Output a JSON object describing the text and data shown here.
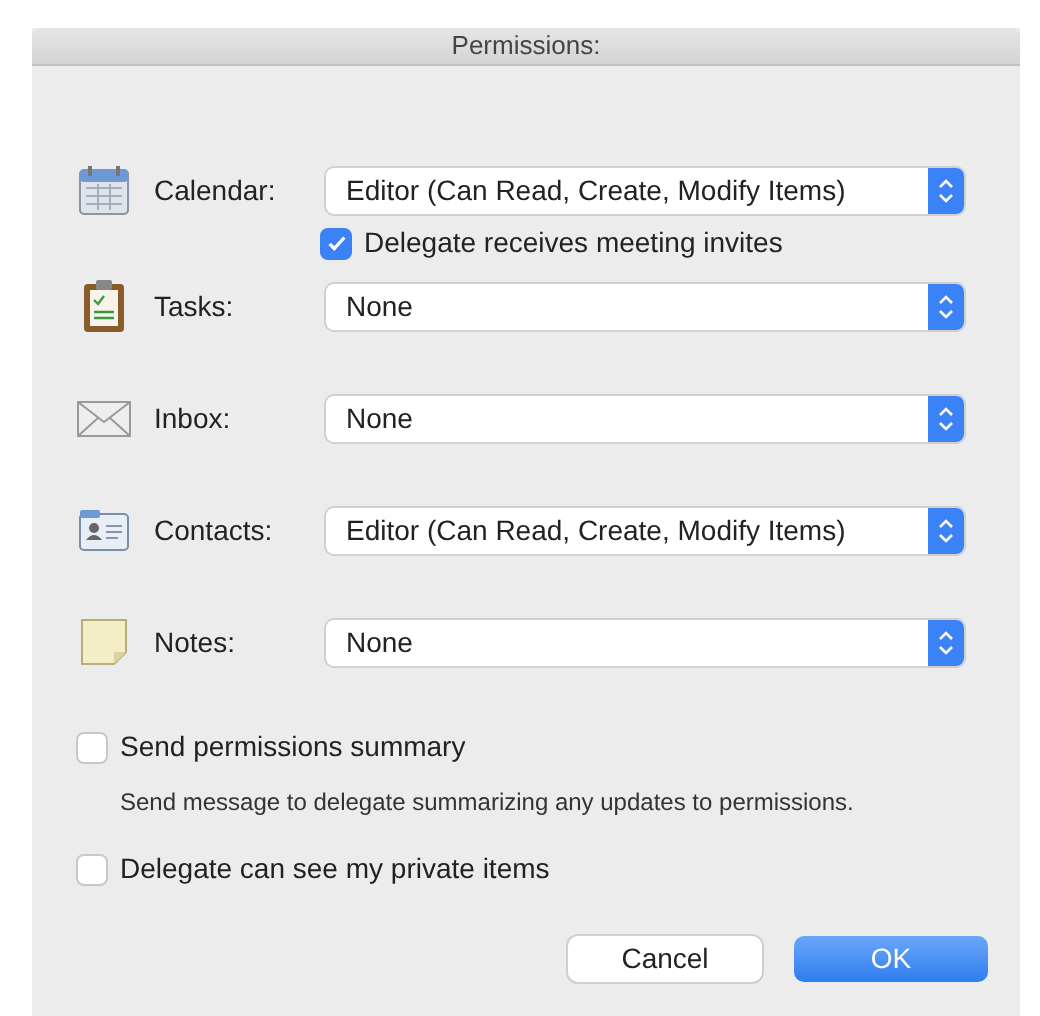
{
  "window": {
    "title": "Permissions:"
  },
  "folders": [
    {
      "kind": "calendar",
      "label": "Calendar:",
      "value": "Editor (Can Read, Create, Modify Items)",
      "option": {
        "label": "Delegate receives meeting invites",
        "checked": true
      }
    },
    {
      "kind": "tasks",
      "label": "Tasks:",
      "value": "None"
    },
    {
      "kind": "inbox",
      "label": "Inbox:",
      "value": "None"
    },
    {
      "kind": "contacts",
      "label": "Contacts:",
      "value": "Editor (Can Read, Create, Modify Items)"
    },
    {
      "kind": "notes",
      "label": "Notes:",
      "value": "None"
    }
  ],
  "options": [
    {
      "label": "Send permissions summary",
      "checked": false,
      "description": "Send message to delegate summarizing any updates to permissions."
    },
    {
      "label": "Delegate can see my private items",
      "checked": false
    }
  ],
  "buttons": [
    {
      "label": "Cancel",
      "kind": "secondary"
    },
    {
      "label": "OK",
      "kind": "primary"
    }
  ]
}
